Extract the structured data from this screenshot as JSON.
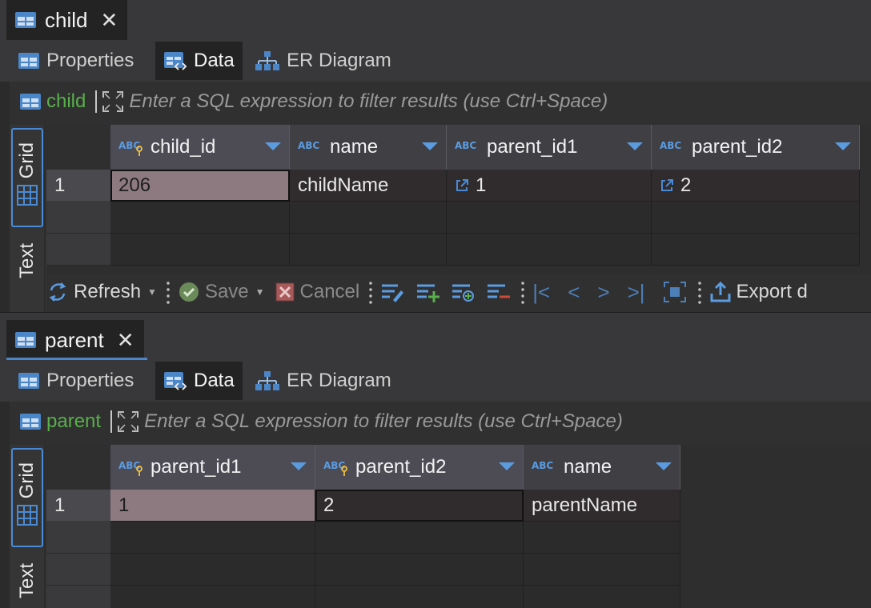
{
  "child_panel": {
    "tab_title": "child",
    "subtabs": [
      "Properties",
      "Data",
      "ER Diagram"
    ],
    "table_name": "child",
    "filter_placeholder": "Enter a SQL expression to filter results (use Ctrl+Space)",
    "side_tabs": [
      "Grid",
      "Text"
    ],
    "columns": [
      {
        "name": "child_id",
        "icon": "abc-key-icon"
      },
      {
        "name": "name",
        "icon": "abc-icon"
      },
      {
        "name": "parent_id1",
        "icon": "abc-icon"
      },
      {
        "name": "parent_id2",
        "icon": "abc-icon"
      }
    ],
    "rows": [
      {
        "num": "1",
        "cells": [
          "206",
          "childName",
          "1",
          "2"
        ]
      }
    ],
    "toolbar": {
      "refresh": "Refresh",
      "save": "Save",
      "cancel": "Cancel",
      "export": "Export d"
    }
  },
  "parent_panel": {
    "tab_title": "parent",
    "subtabs": [
      "Properties",
      "Data",
      "ER Diagram"
    ],
    "table_name": "parent",
    "filter_placeholder": "Enter a SQL expression to filter results (use Ctrl+Space)",
    "side_tabs": [
      "Grid",
      "Text"
    ],
    "columns": [
      {
        "name": "parent_id1",
        "icon": "abc-key-icon"
      },
      {
        "name": "parent_id2",
        "icon": "abc-key-icon"
      },
      {
        "name": "name",
        "icon": "abc-icon"
      }
    ],
    "rows": [
      {
        "num": "1",
        "cells": [
          "1",
          "2",
          "parentName"
        ]
      }
    ]
  },
  "colors": {
    "accent": "#4a86c8",
    "table_name": "#58b04a",
    "selected_cell": "#8c7a80"
  }
}
